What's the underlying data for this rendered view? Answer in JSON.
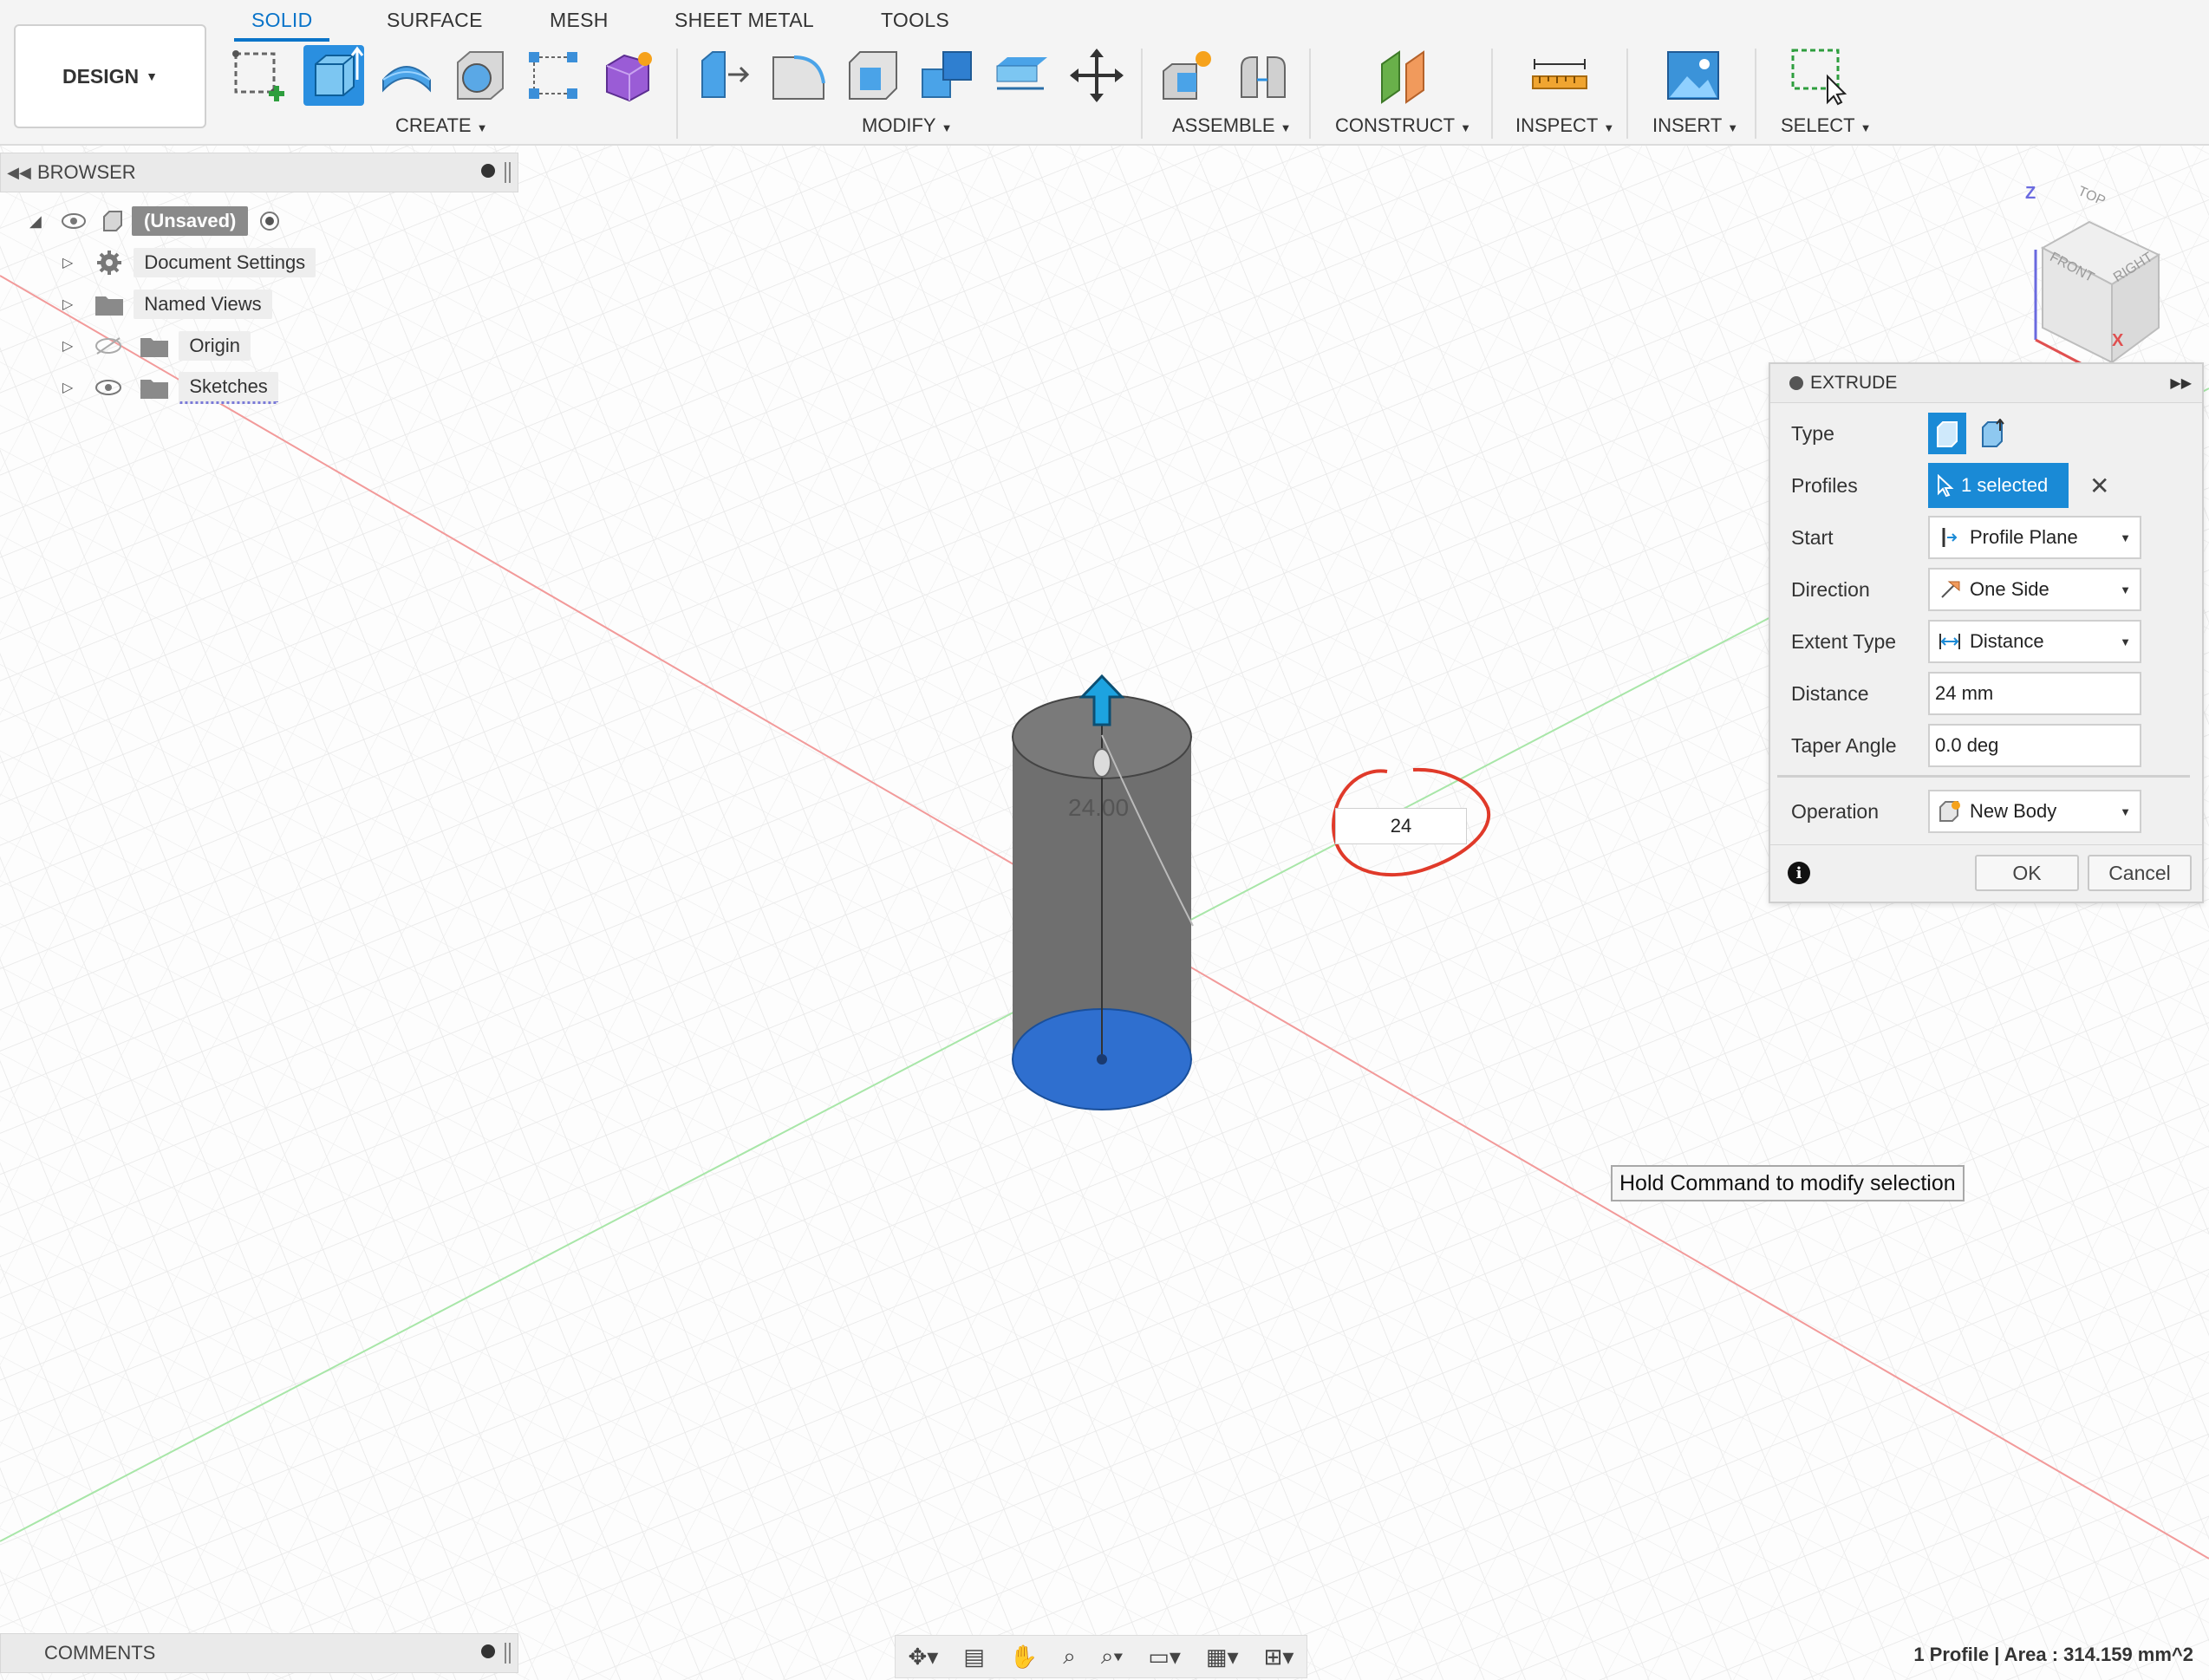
{
  "workspace": {
    "label": "DESIGN"
  },
  "tabs": [
    "SOLID",
    "SURFACE",
    "MESH",
    "SHEET METAL",
    "TOOLS"
  ],
  "toolbar_groups": [
    "CREATE",
    "MODIFY",
    "ASSEMBLE",
    "CONSTRUCT",
    "INSPECT",
    "INSERT",
    "SELECT"
  ],
  "browser": {
    "title": "BROWSER",
    "root": "(Unsaved)",
    "items": [
      {
        "label": "Document Settings",
        "icon": "gear-icon"
      },
      {
        "label": "Named Views",
        "icon": "folder-icon"
      },
      {
        "label": "Origin",
        "icon": "folder-icon",
        "visibility": "hidden-eye-icon"
      },
      {
        "label": "Sketches",
        "icon": "folder-icon",
        "visibility": "eye-icon"
      }
    ]
  },
  "viewcube": {
    "faces": [
      "TOP",
      "FRONT",
      "RIGHT"
    ],
    "axes": [
      "Z",
      "X"
    ]
  },
  "extrude": {
    "title": "EXTRUDE",
    "rows": {
      "type": "Type",
      "profiles": "Profiles",
      "profiles_value": "1 selected",
      "start": "Start",
      "start_value": "Profile Plane",
      "direction": "Direction",
      "direction_value": "One Side",
      "extent_type": "Extent Type",
      "extent_type_value": "Distance",
      "distance": "Distance",
      "distance_value": "24 mm",
      "taper_angle": "Taper Angle",
      "taper_angle_value": "0.0 deg",
      "operation": "Operation",
      "operation_value": "New Body"
    },
    "ok": "OK",
    "cancel": "Cancel"
  },
  "canvas": {
    "dimension_label": "24.00",
    "distance_input": "24",
    "tooltip": "Hold Command to modify selection"
  },
  "comments": {
    "title": "COMMENTS"
  },
  "status": "1 Profile | Area : 314.159 mm^2",
  "colors": {
    "accent": "#0a74c9",
    "selection": "#1a8ad6",
    "profile_face": "#2f6fcf",
    "annotation": "#e03a2a"
  }
}
